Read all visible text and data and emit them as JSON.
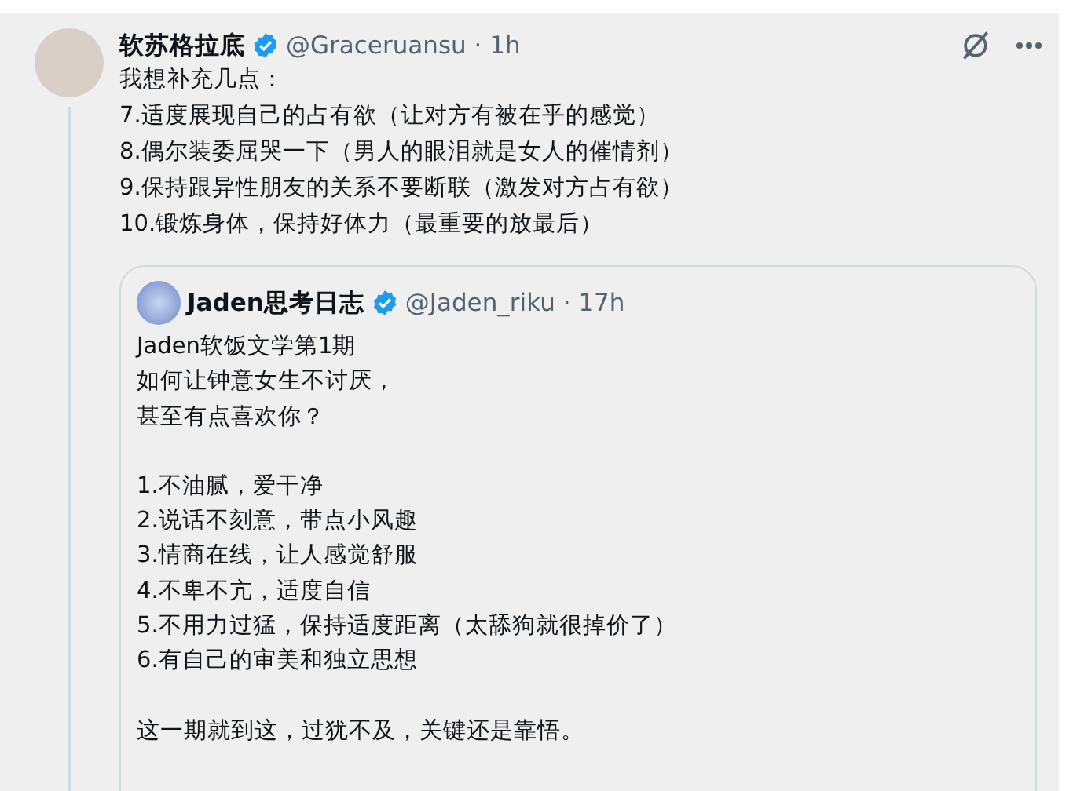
{
  "post": {
    "display_name": "软苏格拉底",
    "verified": true,
    "handle": "@Graceruansu",
    "time": "· 1h",
    "lines": [
      "我想补充几点：",
      "7.适度展现自己的占有欲（让对方有被在乎的感觉）",
      "8.偶尔装委屈哭一下（男人的眼泪就是女人的催情剂）",
      "9.保持跟异性朋友的关系不要断联（激发对方占有欲）",
      "10.锻炼身体，保持好体力（最重要的放最后）"
    ],
    "quoted": {
      "display_name": "Jaden思考日志",
      "verified": true,
      "handle": "@Jaden_riku",
      "time": "· 17h",
      "paragraphs": [
        [
          "Jaden软饭文学第1期",
          "如何让钟意女生不讨厌，",
          "甚至有点喜欢你？"
        ],
        [
          "1.不油腻，爱干净",
          "2.说话不刻意，带点小风趣",
          "3.情商在线，让人感觉舒服",
          "4.不卑不亢，适度自信",
          "5.不用力过猛，保持适度距离（太舔狗就很掉价了）",
          "6.有自己的审美和独立思想"
        ],
        [
          "这一期就到这，过犹不及，关键还是靠悟。"
        ]
      ]
    }
  }
}
